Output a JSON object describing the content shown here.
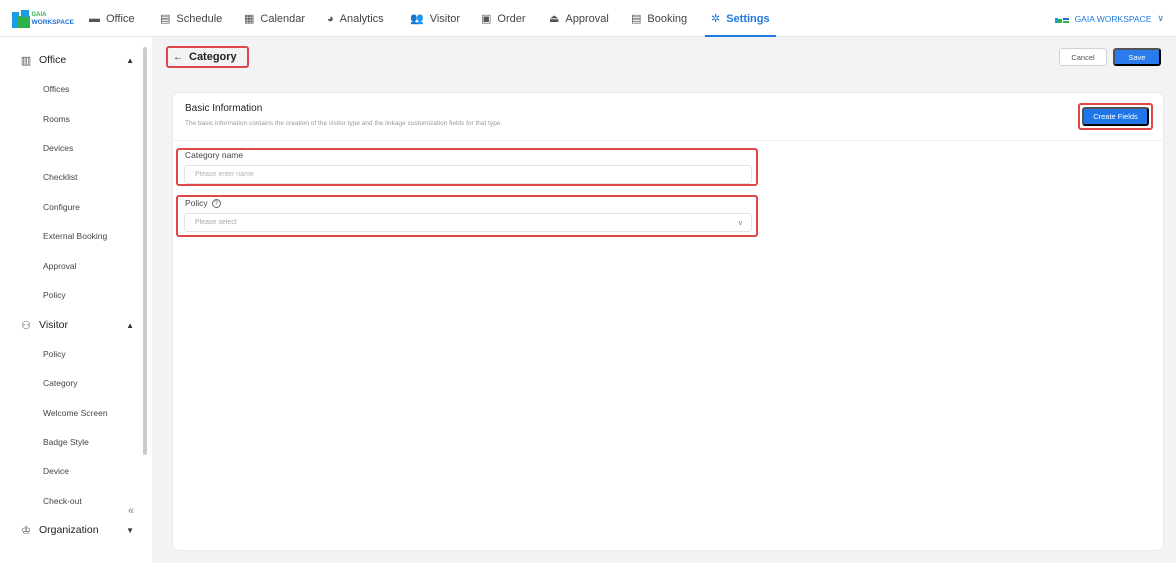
{
  "brand": {
    "line1": "GAIA",
    "line2": "WORKSPACE"
  },
  "topnav": [
    {
      "label": "Office",
      "icon": "office-icon",
      "glyph": "▬"
    },
    {
      "label": "Schedule",
      "icon": "schedule-icon",
      "glyph": "▤"
    },
    {
      "label": "Calendar",
      "icon": "calendar-icon",
      "glyph": "▦"
    },
    {
      "label": "Analytics",
      "icon": "analytics-icon",
      "glyph": "◕"
    },
    {
      "label": "Visitor",
      "icon": "visitor-icon",
      "glyph": "👥"
    },
    {
      "label": "Order",
      "icon": "order-icon",
      "glyph": "▣"
    },
    {
      "label": "Approval",
      "icon": "approval-icon",
      "glyph": "⏏"
    },
    {
      "label": "Booking",
      "icon": "booking-icon",
      "glyph": "▤"
    },
    {
      "label": "Settings",
      "icon": "settings-icon",
      "glyph": "✲",
      "active": true
    }
  ],
  "workspace": {
    "label": "GAIA WORKSPACE",
    "chevron": "∨"
  },
  "sidebar": {
    "office": {
      "label": "Office",
      "caret": "▲",
      "items": [
        "Offices",
        "Rooms",
        "Devices",
        "Checklist",
        "Configure",
        "External Booking",
        "Approval",
        "Policy"
      ]
    },
    "visitor": {
      "label": "Visitor",
      "caret": "▲",
      "items": [
        "Policy",
        "Category",
        "Welcome Screen",
        "Badge Style",
        "Device",
        "Check-out"
      ]
    },
    "organization": {
      "label": "Organization",
      "caret": "▼"
    },
    "collapse_glyph": "«"
  },
  "header": {
    "back_arrow": "←",
    "title": "Category",
    "cancel": "Cancel",
    "save": "Save"
  },
  "section": {
    "title": "Basic Information",
    "description": "The basic information contains the creation of the visitor type and the linkage customization fields for that type.",
    "create_button": "Create Fields"
  },
  "form": {
    "category_name": {
      "label": "Category name",
      "required_mark": "*",
      "placeholder": "Please enter name"
    },
    "policy": {
      "label": "Policy",
      "help": "?",
      "placeholder": "Please select",
      "dropdown_glyph": "∨"
    }
  },
  "colors": {
    "accent": "#1f7ae0",
    "highlight": "#e04646"
  }
}
